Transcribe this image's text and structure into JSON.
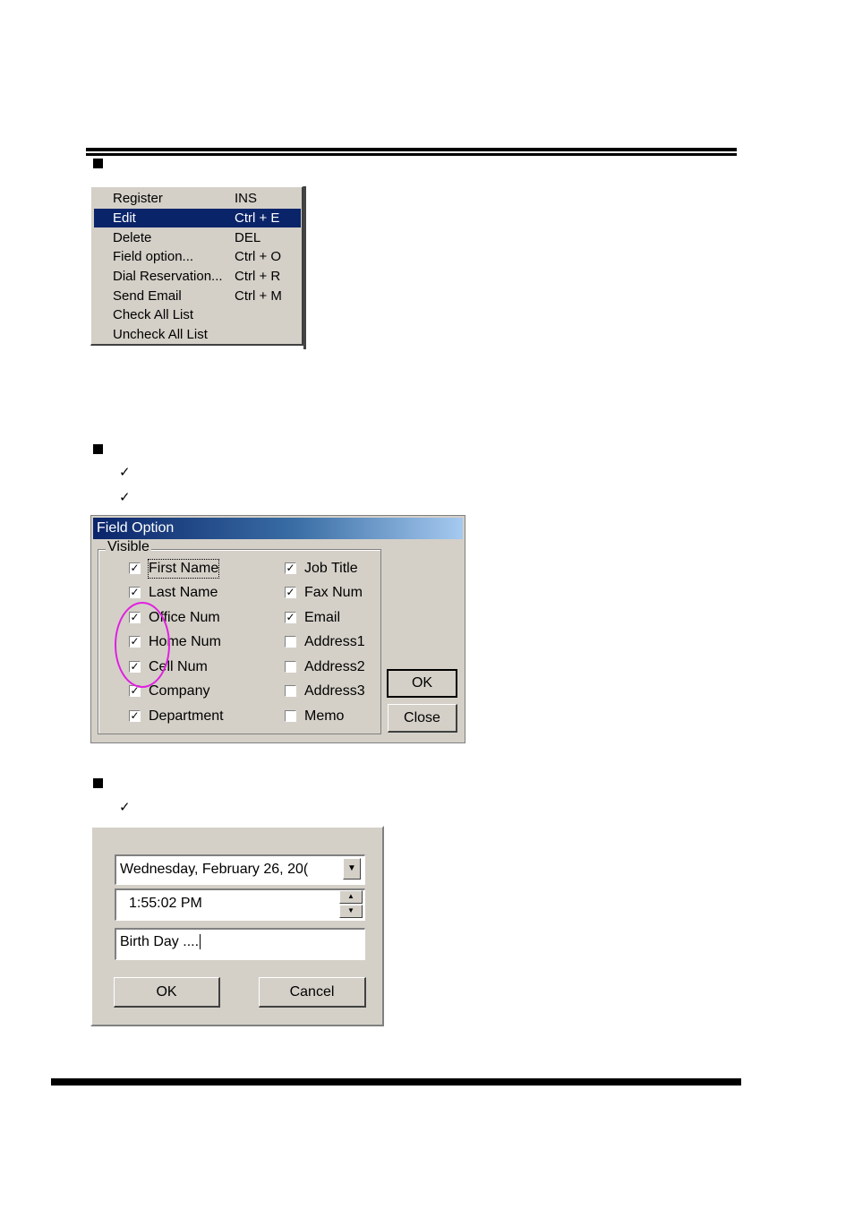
{
  "context_menu": {
    "items": [
      {
        "label": "Register",
        "shortcut": "INS"
      },
      {
        "label": "Edit",
        "shortcut": "Ctrl + E"
      },
      {
        "label": "Delete",
        "shortcut": "DEL"
      },
      {
        "label": "Field option...",
        "shortcut": "Ctrl + O"
      },
      {
        "label": "Dial Reservation...",
        "shortcut": "Ctrl + R"
      },
      {
        "label": "Send Email",
        "shortcut": "Ctrl + M"
      },
      {
        "label": "Check All List",
        "shortcut": ""
      },
      {
        "label": "Uncheck All List",
        "shortcut": ""
      }
    ],
    "highlighted": "Edit"
  },
  "field_option": {
    "title": "Field Option",
    "group_label": "Visible",
    "left_fields": [
      {
        "label": "First Name",
        "checked": true
      },
      {
        "label": "Last Name",
        "checked": true
      },
      {
        "label": "Office Num",
        "checked": true
      },
      {
        "label": "Home Num",
        "checked": true
      },
      {
        "label": "Cell Num",
        "checked": true
      },
      {
        "label": "Company",
        "checked": true
      },
      {
        "label": "Department",
        "checked": true
      }
    ],
    "right_fields": [
      {
        "label": "Job Title",
        "checked": true
      },
      {
        "label": "Fax Num",
        "checked": true
      },
      {
        "label": "Email",
        "checked": true
      },
      {
        "label": "Address1",
        "checked": false
      },
      {
        "label": "Address2",
        "checked": false
      },
      {
        "label": "Address3",
        "checked": false
      },
      {
        "label": "Memo",
        "checked": false
      }
    ],
    "ok_label": "OK",
    "close_label": "Close",
    "highlight_color": "#e020e0"
  },
  "reservation": {
    "date_value": "Wednesday,  February  26, 20(",
    "time_value": "1:55:02 PM",
    "memo_value": "Birth Day ....",
    "ok_label": "OK",
    "cancel_label": "Cancel"
  },
  "icons": {
    "bullet": "square-bullet-icon",
    "check": "checkmark-icon",
    "dropdown": "chevron-down-icon"
  },
  "colors": {
    "menu_highlight": "#0a246a",
    "dialog_face": "#d4d0c8"
  }
}
